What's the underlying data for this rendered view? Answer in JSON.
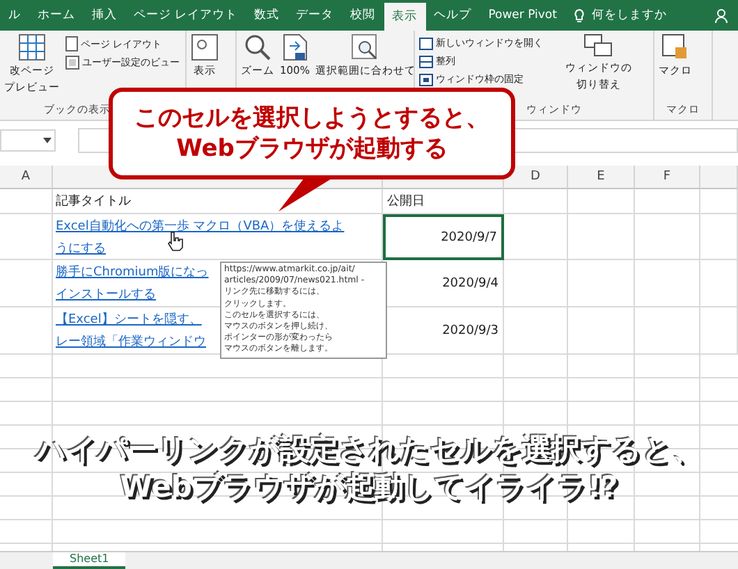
{
  "ribbon_tabs": [
    {
      "label": "ル",
      "selected": false
    },
    {
      "label": "ホーム",
      "selected": false
    },
    {
      "label": "挿入",
      "selected": false
    },
    {
      "label": "ページ レイアウト",
      "selected": false
    },
    {
      "label": "数式",
      "selected": false
    },
    {
      "label": "データ",
      "selected": false
    },
    {
      "label": "校閲",
      "selected": false
    },
    {
      "label": "表示",
      "selected": true
    },
    {
      "label": "ヘルプ",
      "selected": false
    },
    {
      "label": "Power Pivot",
      "selected": false
    }
  ],
  "tell_me": "何をしますか",
  "ribbon": {
    "page_break_preview": [
      "改ページ",
      "プレビュー"
    ],
    "page_layout": "ページ レイアウト",
    "custom_views": "ユーザー設定のビュー",
    "workbook_views_label": "ブックの表示",
    "show": "表示",
    "zoom": "ズーム",
    "zoom_100": "100%",
    "zoom_selection": "選択範囲に合わせて",
    "new_window": "新しいウィンドウを開く",
    "arrange": "整列",
    "freeze": "ウィンドウ枠の固定",
    "switch_windows": [
      "ウィンドウの",
      "切り替え"
    ],
    "window_label": "ウィンドウ",
    "macros": "マクロ",
    "macros_label": "マクロ"
  },
  "columns_left": [
    "A"
  ],
  "columns_right": [
    "D",
    "E",
    "F"
  ],
  "rows": [
    {
      "title": [
        "記事タイトル"
      ],
      "link": false,
      "date": "公開日",
      "selected": false
    },
    {
      "title": [
        "Excel自動化への第一歩 マクロ（VBA）を使えるよ",
        "うにする"
      ],
      "link": true,
      "date": "2020/9/7",
      "selected": true
    },
    {
      "title": [
        "勝手にChromium版になっ",
        "インストールする"
      ],
      "link": true,
      "date": "2020/9/4",
      "selected": false
    },
    {
      "title": [
        "【Excel】シートを隠す、",
        "レー領域「作業ウィンドウ"
      ],
      "link": true,
      "date": "2020/9/3",
      "selected": false
    }
  ],
  "callout": [
    "このセルを選択しようとすると、",
    "Webブラウザが起動する"
  ],
  "tooltip": [
    "https://www.atmarkit.co.jp/ait/",
    "articles/2009/07/news021.html -",
    "リンク先に移動するには、",
    "クリックします。",
    "このセルを選択するには、",
    "マウスのボタンを押し続け、",
    "ポインターの形が変わったら",
    "マウスのボタンを離します。"
  ],
  "caption": [
    "ハイパーリンクが設定されたセルを選択すると、",
    "Webブラウザが起動してイライラ!?"
  ],
  "sheet_tabs": [
    {
      "label": "Sheet1",
      "selected": true
    }
  ]
}
